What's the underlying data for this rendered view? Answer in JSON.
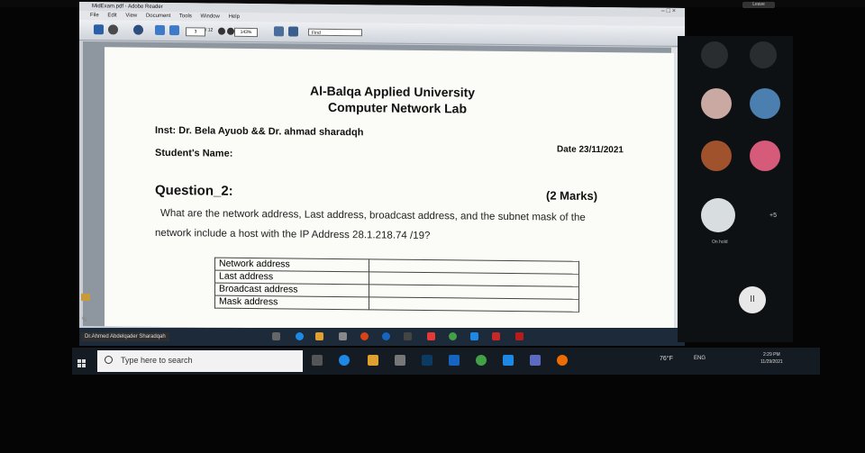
{
  "window": {
    "title": "MidExam.pdf - Adobe Reader",
    "menu": [
      "File",
      "Edit",
      "View",
      "Document",
      "Tools",
      "Window",
      "Help"
    ],
    "controls": "–  □  ×"
  },
  "toolbar": {
    "page_field": "3",
    "page_total": "/ 12",
    "zoom": "143%",
    "find_placeholder": "Find"
  },
  "document": {
    "university": "Al-Balqa Applied University",
    "lab": "Computer Network Lab",
    "instructors": "Inst: Dr. Bela Ayuob && Dr. ahmad sharadqh",
    "date": "Date 23/11/2021",
    "student_name_label": "Student's Name:",
    "question_title": "Question_2:",
    "marks": "(2 Marks)",
    "question_line1": "What are the network address, Last address, broadcast address, and the subnet mask of the",
    "question_line2": "network include a host with the IP Address 28.1.218.74 /19?",
    "table_rows": [
      {
        "label": "Network address",
        "value": ""
      },
      {
        "label": "Last address",
        "value": ""
      },
      {
        "label": "Broadcast address",
        "value": ""
      },
      {
        "label": "Mask address",
        "value": ""
      }
    ]
  },
  "presenter": {
    "name": "Dr.Ahmed Abdelqader Sharadqah"
  },
  "taskbar": {
    "search_placeholder": "Type here to search",
    "weather": "76°F",
    "tray_lang": "ENG",
    "clock_time": "2:29 PM",
    "clock_date": "11/29/2021"
  },
  "meeting": {
    "leave_label": "Leave",
    "on_hold": "On hold",
    "more_count": "+5",
    "pause_symbol": "II"
  },
  "colors": {
    "page_bg": "#fbfbf8",
    "taskbar_bg": "#151b22",
    "meeting_bg": "#0e1114"
  }
}
